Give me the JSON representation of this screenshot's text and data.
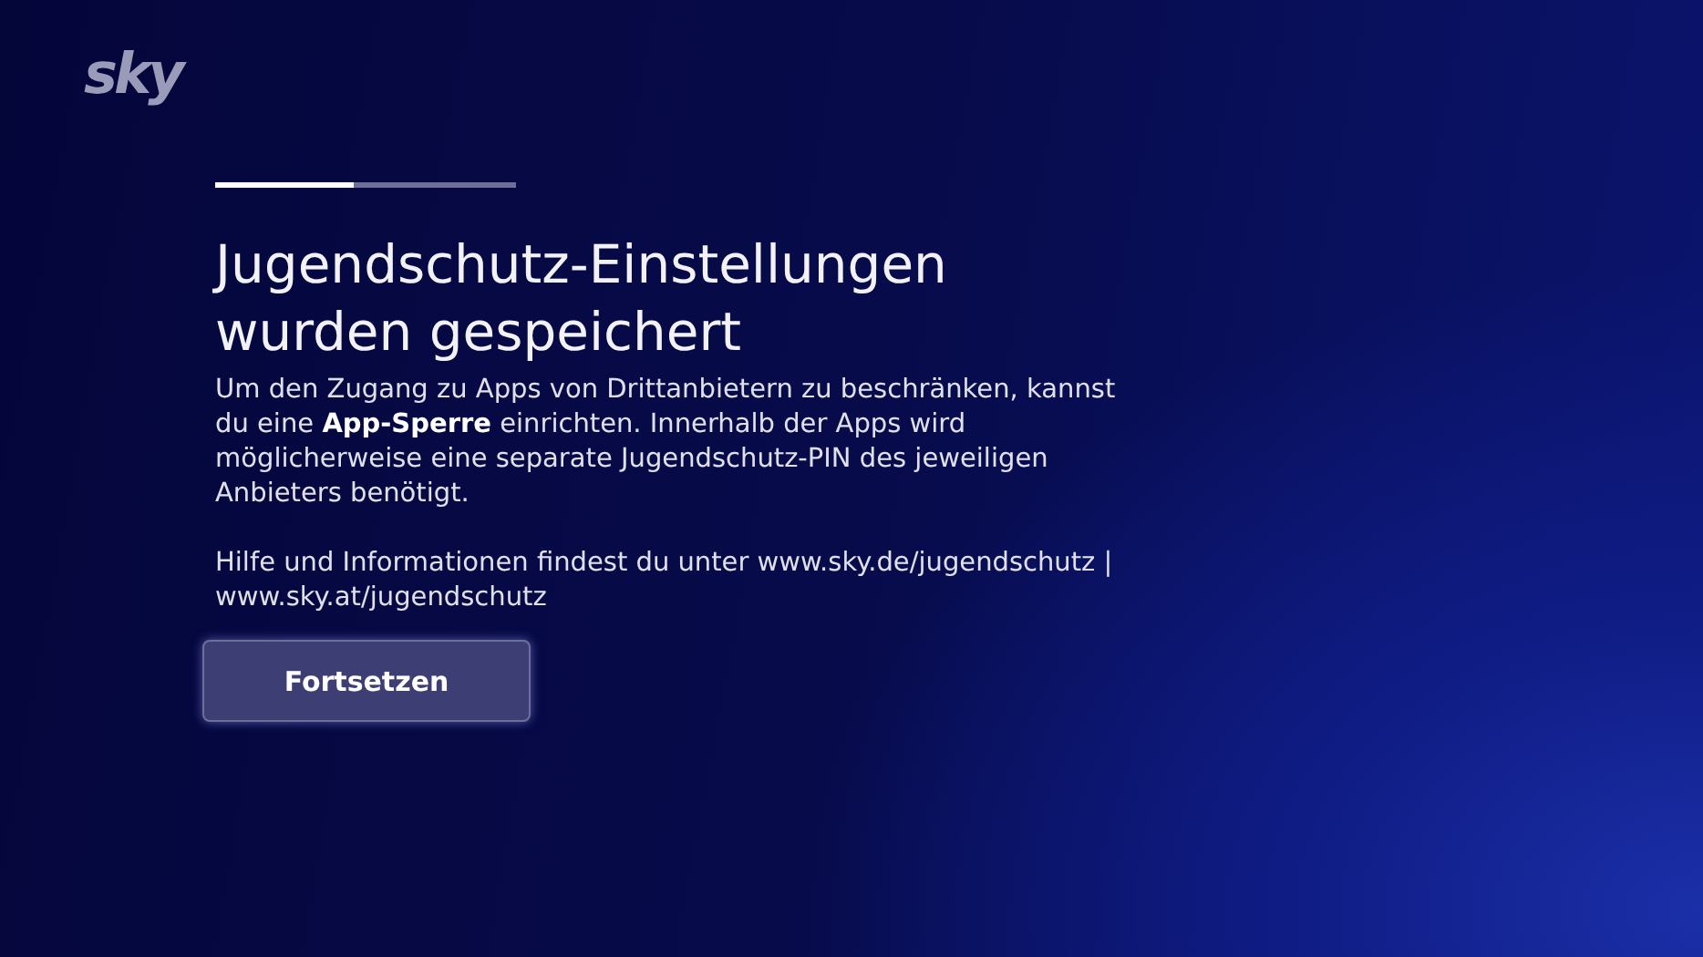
{
  "logo": "sky",
  "progress": {
    "level": 0.46
  },
  "title": "Jugendschutz-Einstellungen wurden gespeichert",
  "paragraphs": [
    "Um den Zugang zu Apps von Drittanbietern zu beschränken, kannst du eine **App-Sperre** einrichten. Innerhalb der Apps wird möglicherweise eine separate Jugendschutz-PIN des jeweiligen Anbieters benötigt.",
    "Hilfe und Informationen findest du unter  www.sky.de/jugendschutz | www.sky.at/jugendschutz"
  ],
  "button": {
    "label": "Fortsetzen",
    "focused": true
  }
}
